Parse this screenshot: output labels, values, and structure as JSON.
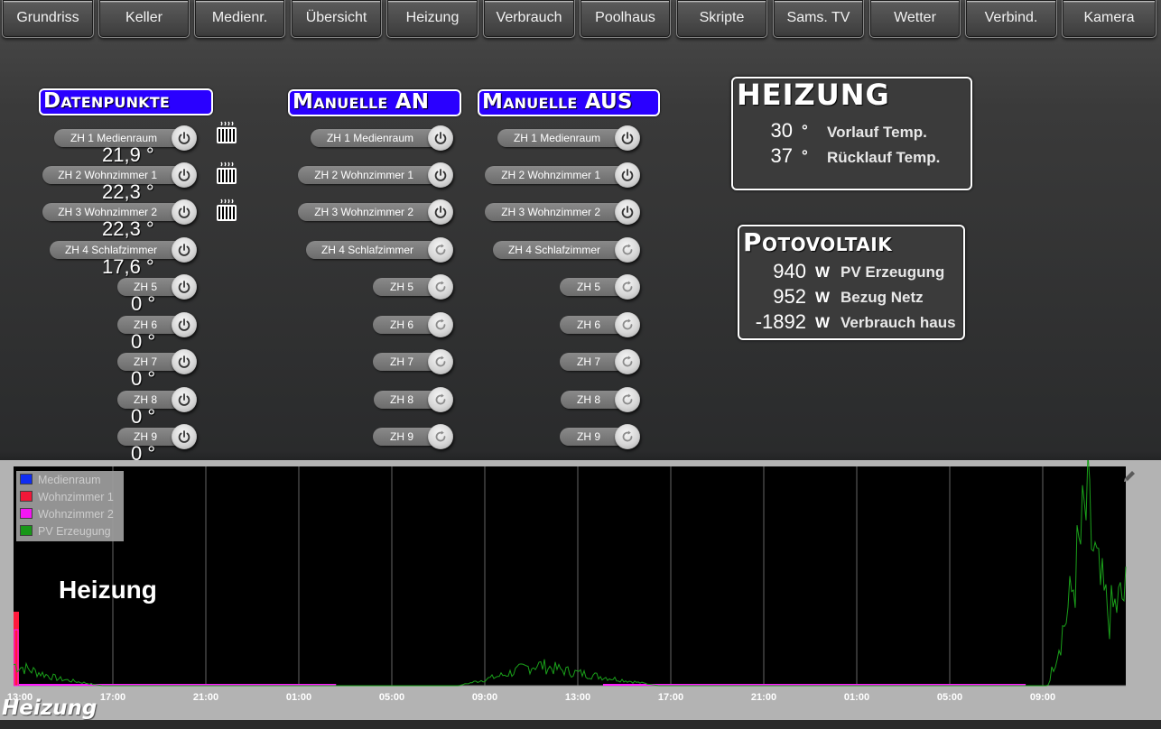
{
  "nav": {
    "items": [
      "Grundriss",
      "Keller",
      "Medienr.",
      "Übersicht",
      "Heizung",
      "Verbrauch",
      "Poolhaus",
      "Skripte",
      "Sams. TV",
      "Wetter",
      "Verbind.",
      "Kamera"
    ]
  },
  "datenpunkte": {
    "title": "Datenpunkte",
    "rows": [
      {
        "label": "ZH 1 Medienraum",
        "value": "21,9 °"
      },
      {
        "label": "ZH 2 Wohnzimmer 1",
        "value": "22,3 °"
      },
      {
        "label": "ZH 3 Wohnzimmer 2",
        "value": "22,3 °"
      },
      {
        "label": "ZH 4 Schlafzimmer",
        "value": "17,6 °"
      },
      {
        "label": "ZH 5",
        "value": "0 °"
      },
      {
        "label": "ZH 6",
        "value": "0 °"
      },
      {
        "label": "ZH 7",
        "value": "0 °"
      },
      {
        "label": "ZH 8",
        "value": "0 °"
      },
      {
        "label": "ZH 9",
        "value": "0 °"
      }
    ],
    "radiator_icon": "radiator-icon"
  },
  "manuell_an": {
    "title": "Manuelle AN",
    "rows": [
      "ZH 1 Medienraum",
      "ZH 2 Wohnzimmer 1",
      "ZH 3 Wohnzimmer 2",
      "ZH 4 Schlafzimmer",
      "ZH 5",
      "ZH 6",
      "ZH 7",
      "ZH 8",
      "ZH 9"
    ]
  },
  "manuell_aus": {
    "title": "Manuelle AUS",
    "rows": [
      "ZH 1 Medienraum",
      "ZH 2 Wohnzimmer 1",
      "ZH 3 Wohnzimmer 2",
      "ZH 4 Schlafzimmer",
      "ZH 5",
      "ZH 6",
      "ZH 7",
      "ZH 8",
      "ZH 9"
    ]
  },
  "heizung_box": {
    "title": "HEIZUNG",
    "rows": [
      {
        "value": "30",
        "unit": "°",
        "label": "Vorlauf Temp."
      },
      {
        "value": "37",
        "unit": "°",
        "label": "Rücklauf Temp."
      }
    ]
  },
  "pv_box": {
    "title": "Potovoltaik",
    "rows": [
      {
        "value": "940",
        "unit": "W",
        "label": "PV Erzeugung"
      },
      {
        "value": "952",
        "unit": "W",
        "label": "Bezug Netz"
      },
      {
        "value": "-1892",
        "unit": "W",
        "label": "Verbrauch haus"
      }
    ]
  },
  "chart": {
    "heading": "Heizung",
    "subtitle": "Heizung",
    "edit_icon": "pencil-icon"
  },
  "colors": {
    "heading_bg": "#2a00ff",
    "medienraum": "#1030ff",
    "wohnzimmer1": "#ff1a3c",
    "wohnzimmer2": "#ff19ff",
    "pv": "#1aa01a"
  },
  "chart_data": {
    "type": "line",
    "title": "",
    "legend": [
      "Medienraum",
      "Wohnzimmer 1",
      "Wohnzimmer 2",
      "PV Erzeugung"
    ],
    "legend_position": "top-left",
    "x_ticks": [
      "13:00",
      "17:00",
      "21:00",
      "01:00",
      "05:00",
      "09:00",
      "13:00",
      "17:00",
      "21:00",
      "01:00",
      "05:00",
      "09:00"
    ],
    "grid": true,
    "series": [
      {
        "name": "Medienraum",
        "color": "#1030ff",
        "values": []
      },
      {
        "name": "Wohnzimmer 1",
        "color": "#ff1a3c",
        "spike": [
          0.0,
          0.11
        ],
        "flat_level": 0.0
      },
      {
        "name": "Wohnzimmer 2",
        "color": "#ff19ff",
        "segments": [
          [
            0.0,
            0.29
          ],
          [
            0.53,
            0.91
          ]
        ],
        "level": 0.0
      },
      {
        "name": "PV Erzeugung",
        "color": "#1aa01a",
        "peaks": [
          {
            "x": 0.0,
            "y": 0.03
          },
          {
            "x": 0.04,
            "y": 0.01
          },
          {
            "x": 0.08,
            "y": 0.0
          },
          {
            "x": 0.4,
            "y": 0.0
          },
          {
            "x": 0.44,
            "y": 0.015
          },
          {
            "x": 0.47,
            "y": 0.03
          },
          {
            "x": 0.5,
            "y": 0.02
          },
          {
            "x": 0.54,
            "y": 0.01
          },
          {
            "x": 0.58,
            "y": 0.0
          },
          {
            "x": 0.93,
            "y": 0.0
          },
          {
            "x": 0.95,
            "y": 0.12
          },
          {
            "x": 0.965,
            "y": 0.25
          },
          {
            "x": 0.975,
            "y": 0.15
          },
          {
            "x": 0.985,
            "y": 0.1
          },
          {
            "x": 1.0,
            "y": 0.13
          }
        ]
      }
    ]
  }
}
